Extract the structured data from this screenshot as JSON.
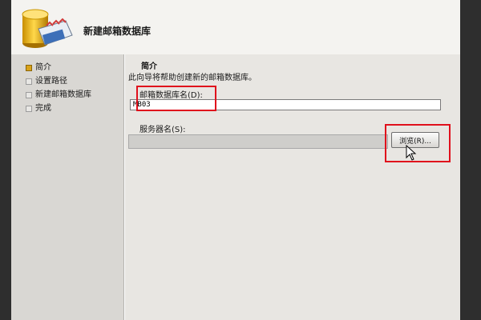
{
  "wizard": {
    "title": "新建邮箱数据库"
  },
  "steps": [
    {
      "label": "简介",
      "active": true
    },
    {
      "label": "设置路径",
      "active": false
    },
    {
      "label": "新建邮箱数据库",
      "active": false
    },
    {
      "label": "完成",
      "active": false
    }
  ],
  "content": {
    "section_title": "简介",
    "description": "此向导将帮助创建新的邮箱数据库。",
    "db_name_label": "邮箱数据库名(D):",
    "db_name_value": "MB03",
    "server_label": "服务器名(S):",
    "server_value": "",
    "browse_label": "浏览(R)..."
  },
  "colors": {
    "highlight": "#e0101c",
    "active_step": "#d9a21a"
  }
}
